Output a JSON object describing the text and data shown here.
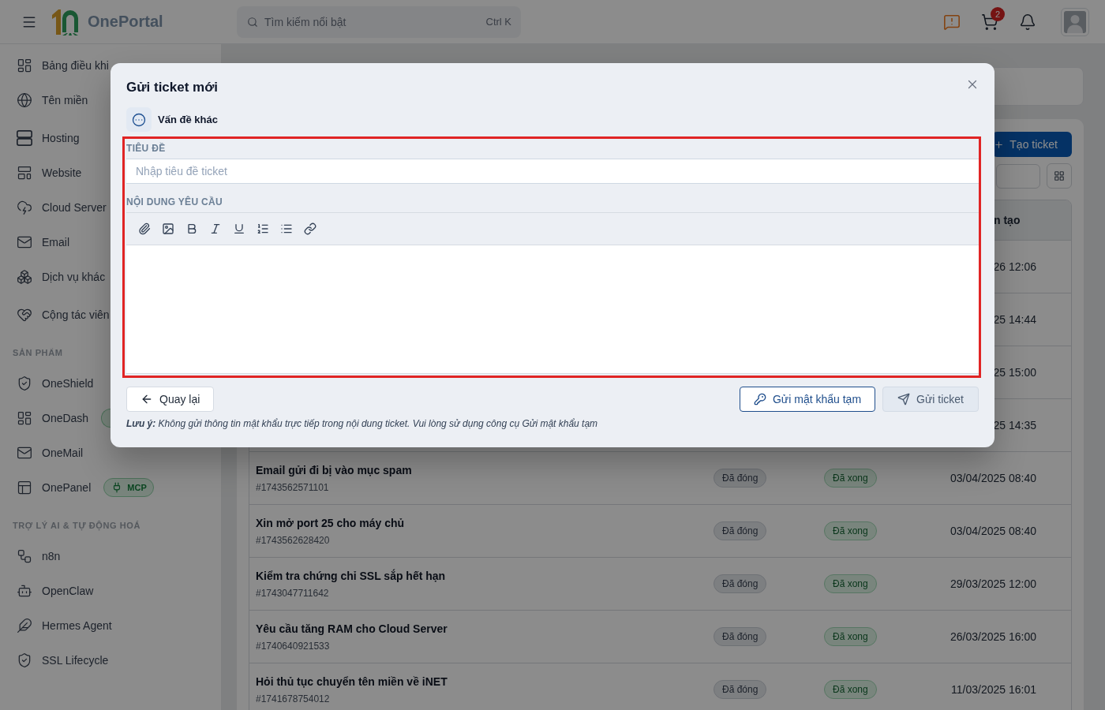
{
  "header": {
    "logo_text": "OnePortal",
    "search": {
      "placeholder": "Tìm kiếm nổi bật",
      "shortcut": "Ctrl K"
    },
    "cart_count": "2"
  },
  "sidebar": {
    "sections": [
      {
        "items": [
          {
            "label": "Bảng điều khi"
          },
          {
            "label": "Tên miền"
          }
        ]
      },
      {
        "items": [
          {
            "label": "Hosting"
          },
          {
            "label": "Website"
          },
          {
            "label": "Cloud Server"
          },
          {
            "label": "Email"
          },
          {
            "label": "Dịch vụ khác"
          }
        ]
      },
      {
        "items": [
          {
            "label": "Cộng tác viên"
          }
        ]
      },
      {
        "title": "SẢN PHẨM",
        "items": [
          {
            "label": "OneShield"
          },
          {
            "label": "OneDash",
            "badge": {
              "clipped": true
            }
          },
          {
            "label": "OneMail"
          },
          {
            "label": "OnePanel",
            "badge": {
              "clipped": false,
              "text": "MCP"
            }
          }
        ]
      },
      {
        "title": "TRỢ LÝ AI & TỰ ĐỘNG HOÁ",
        "items": [
          {
            "label": "n8n"
          },
          {
            "label": "OpenClaw"
          },
          {
            "label": "Hermes Agent"
          },
          {
            "label": "SSL Lifecycle"
          }
        ]
      }
    ]
  },
  "main": {
    "create_button": "Tạo ticket",
    "table": {
      "column_4_header": "n tạo",
      "rows": [
        {
          "column_4": "26 12:06"
        },
        {
          "column_4": "25 14:44"
        },
        {
          "column_4": "25 15:00"
        },
        {
          "column_4": "25 14:35"
        },
        {
          "column_1": "Email gửi đi bị vào mục spam",
          "column_1_detail": "#1743562571101",
          "column_2": "Đã đóng",
          "column_3": "Đã xong",
          "column_4": "03/04/2025 08:40"
        },
        {
          "column_1": "Xin mở port 25 cho máy chủ",
          "column_1_detail": "#1743562628420",
          "column_2": "Đã đóng",
          "column_3": "Đã xong",
          "column_4": "03/04/2025 08:40"
        },
        {
          "column_1": "Kiểm tra chứng chỉ SSL sắp hết hạn",
          "column_1_detail": "#1743047711642",
          "column_2": "Đã đóng",
          "column_3": "Đã xong",
          "column_4": "29/03/2025 12:00"
        },
        {
          "column_1": "Yêu cầu tăng RAM cho Cloud Server",
          "column_1_detail": "#1740640921533",
          "column_2": "Đã đóng",
          "column_3": "Đã xong",
          "column_4": "26/03/2025 16:00"
        },
        {
          "column_1": "Hỏi thủ tục chuyển tên miền về iNET",
          "column_1_detail": "#1741678754012",
          "column_2": "Đã đóng",
          "column_3": "Đã xong",
          "column_4": "11/03/2025 16:01"
        }
      ]
    }
  },
  "modal": {
    "title": "Gửi ticket mới",
    "category": {
      "label": "Vấn đề khác"
    },
    "form": {
      "highlighted": true,
      "fields": [
        {
          "kind": "text",
          "label": "TIÊU ĐỀ",
          "placeholder": "Nhập tiêu đề ticket"
        },
        {
          "kind": "editor",
          "label": "NỘI DUNG YÊU CẦU"
        }
      ]
    },
    "buttons": [
      {
        "kind": "back",
        "label": "Quay lại",
        "disabled": false
      },
      {
        "kind": "outline",
        "label": "Gửi mật khẩu tạm",
        "disabled": false
      },
      {
        "kind": "primary",
        "label": "Gửi ticket",
        "disabled": true
      }
    ],
    "note": "**Lưu ý:** Không gửi thông tin mật khẩu trực tiếp trong nội dung ticket. Vui lòng sử dụng công cụ Gửi mật khẩu tạm"
  }
}
